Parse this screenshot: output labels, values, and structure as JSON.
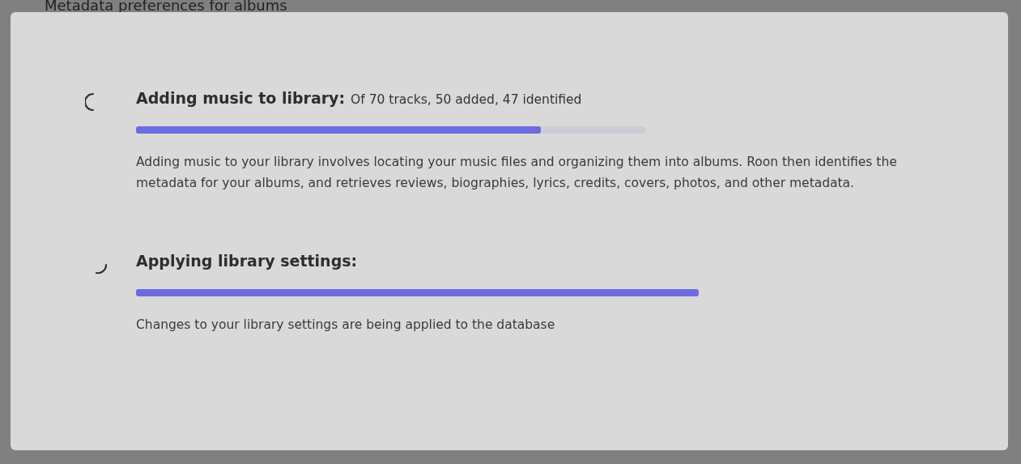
{
  "background_page": {
    "heading": "Metadata preferences for albums"
  },
  "dialog": {
    "tasks": [
      {
        "title": "Adding music to library:",
        "status": "Of 70 tracks, 50 added, 47 identified",
        "level": 0.794,
        "description": "Adding music to your library involves locating your music files and organizing them into albums. Roon then identifies the metadata for your albums, and retrieves reviews, biographies, lyrics, credits, covers, photos, and other metadata."
      },
      {
        "title": "Applying library settings:",
        "level": 1,
        "description": "Changes to your library settings are being applied to the database"
      }
    ]
  }
}
